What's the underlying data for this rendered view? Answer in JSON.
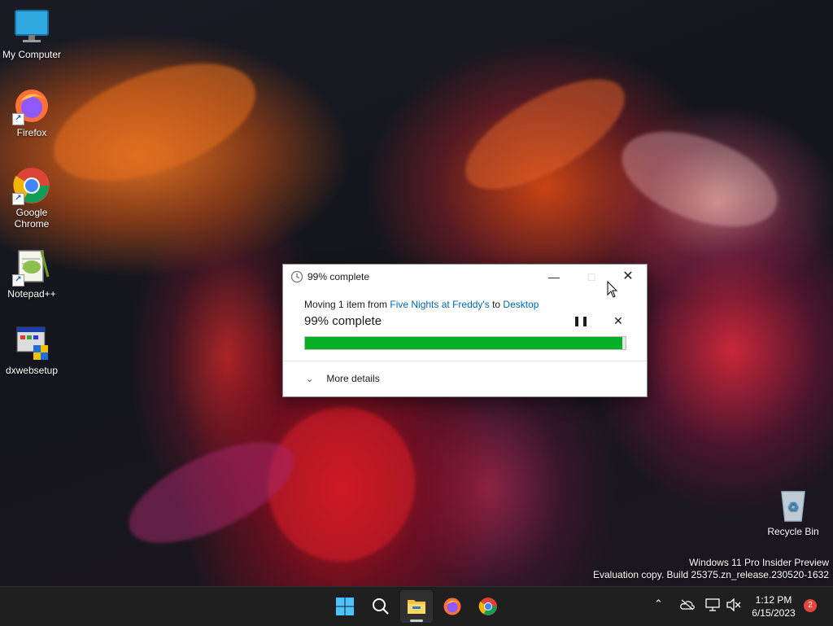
{
  "desktop": {
    "icons": [
      {
        "label": "My Computer"
      },
      {
        "label": "Firefox"
      },
      {
        "label": "Google Chrome"
      },
      {
        "label": "Notepad++"
      },
      {
        "label": "dxwebsetup"
      },
      {
        "label": "Recycle Bin"
      }
    ],
    "watermark": {
      "line1": "Windows 11 Pro Insider Preview",
      "line2": "Evaluation copy. Build 25375.zn_release.230520-1632"
    }
  },
  "dialog": {
    "title": "99% complete",
    "status_prefix": "Moving 1 item from",
    "source": "Five Nights at Freddy's",
    "to_word": "to",
    "destination": "Desktop",
    "progress_label": "99% complete",
    "progress": 0.99,
    "more_details": "More details",
    "colors": {
      "progress": "#06b025",
      "link": "#0066b4"
    }
  },
  "taskbar": {
    "apps": [
      "start-icon",
      "search-icon",
      "file-explorer-icon",
      "firefox-icon",
      "chrome-icon"
    ],
    "time": "1:12 PM",
    "date": "6/15/2023",
    "notification_count": "2"
  }
}
